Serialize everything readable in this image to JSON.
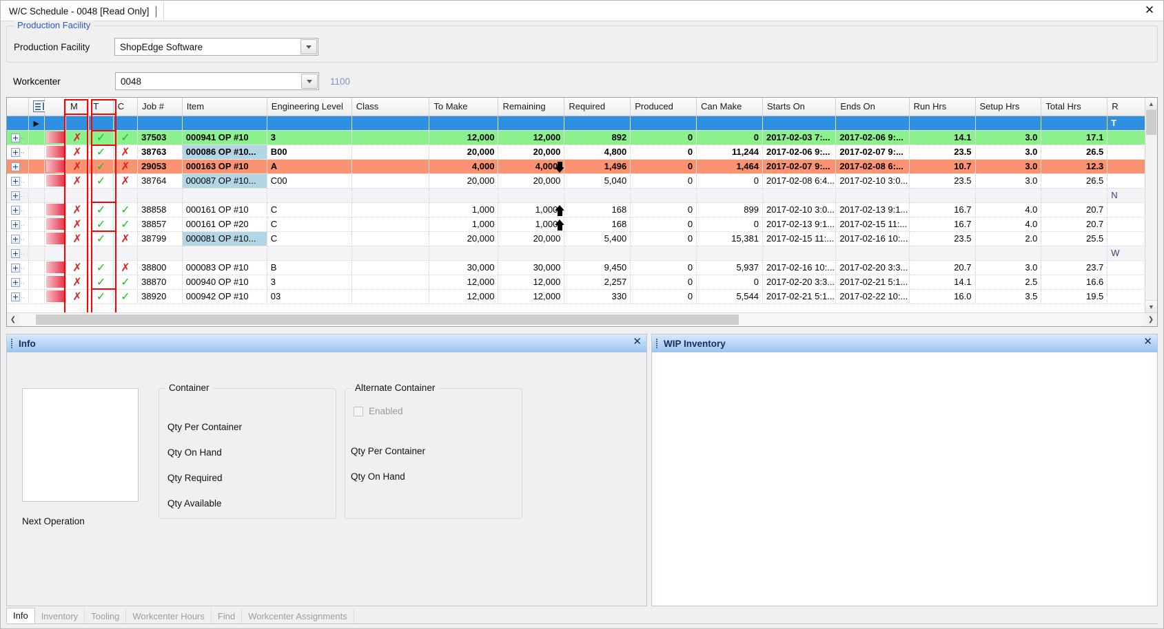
{
  "window": {
    "doc_tab_title": "W/C Schedule - 0048 [Read Only]",
    "close_label": "✕"
  },
  "form": {
    "group_title": "Production Facility",
    "facility_label": "Production Facility",
    "facility_value": "ShopEdge Software",
    "workcenter_label": "Workcenter",
    "workcenter_value": "0048",
    "workcenter_extra": "1100"
  },
  "grid": {
    "columns": [
      {
        "key": "exp",
        "label": ""
      },
      {
        "key": "ind",
        "label": ""
      },
      {
        "key": "mark",
        "label": ""
      },
      {
        "key": "m",
        "label": "M"
      },
      {
        "key": "t",
        "label": "T"
      },
      {
        "key": "c",
        "label": "C"
      },
      {
        "key": "job",
        "label": "Job #"
      },
      {
        "key": "item",
        "label": "Item"
      },
      {
        "key": "eng",
        "label": "Engineering Level"
      },
      {
        "key": "class",
        "label": "Class"
      },
      {
        "key": "tomake",
        "label": "To Make"
      },
      {
        "key": "rem",
        "label": "Remaining"
      },
      {
        "key": "req",
        "label": "Required"
      },
      {
        "key": "prod",
        "label": "Produced"
      },
      {
        "key": "canm",
        "label": "Can Make"
      },
      {
        "key": "start",
        "label": "Starts On"
      },
      {
        "key": "end",
        "label": "Ends On"
      },
      {
        "key": "run",
        "label": "Run Hrs"
      },
      {
        "key": "setup",
        "label": "Setup Hrs"
      },
      {
        "key": "total",
        "label": "Total Hrs"
      },
      {
        "key": "r",
        "label": "R"
      }
    ],
    "rows": [
      {
        "state": "selected",
        "m": "",
        "t": "",
        "c": "",
        "job": "",
        "item": "",
        "eng": "",
        "class": "",
        "tomake": "",
        "rem": "",
        "req": "",
        "prod": "",
        "canm": "",
        "start": "",
        "end": "",
        "run": "",
        "setup": "",
        "total": "",
        "r": "T"
      },
      {
        "state": "green",
        "m": "x",
        "t": "check",
        "c": "check",
        "job": "37503",
        "item": "000941 OP #10",
        "eng": "3",
        "class": "",
        "tomake": "12,000",
        "rem": "12,000",
        "req": "892",
        "prod": "0",
        "canm": "0",
        "start": "2017-02-03 7:...",
        "end": "2017-02-06 9:...",
        "run": "14.1",
        "setup": "3.0",
        "total": "17.1",
        "r": ""
      },
      {
        "state": "white",
        "m": "x",
        "t": "check",
        "c": "x",
        "job": "38763",
        "item": "000086 OP #10...",
        "item_highlight": true,
        "eng": "B00",
        "class": "",
        "tomake": "20,000",
        "rem": "20,000",
        "req": "4,800",
        "prod": "0",
        "canm": "11,244",
        "start": "2017-02-06 9:...",
        "end": "2017-02-07 9:...",
        "run": "23.5",
        "setup": "3.0",
        "total": "26.5",
        "r": "",
        "bold": true
      },
      {
        "state": "orange",
        "m": "x",
        "t": "check",
        "c": "x",
        "job": "29053",
        "item": "000163 OP #10",
        "eng": "A",
        "class": "",
        "tomake": "4,000",
        "rem": "4,000",
        "rem_arrow": "down",
        "req": "1,496",
        "prod": "0",
        "canm": "1,464",
        "start": "2017-02-07 9:...",
        "end": "2017-02-08 6:...",
        "run": "10.7",
        "setup": "3.0",
        "total": "12.3",
        "r": ""
      },
      {
        "state": "white",
        "m": "x",
        "t": "check",
        "c": "x",
        "job": "38764",
        "item": "000087 OP #10...",
        "item_highlight": true,
        "eng": "C00",
        "class": "",
        "tomake": "20,000",
        "rem": "20,000",
        "req": "5,040",
        "prod": "0",
        "canm": "0",
        "start": "2017-02-08 6:4...",
        "end": "2017-02-10 3:0...",
        "run": "23.5",
        "setup": "3.0",
        "total": "26.5",
        "r": ""
      },
      {
        "state": "separator",
        "m": "",
        "t": "",
        "c": "",
        "job": "",
        "item": "",
        "eng": "",
        "class": "",
        "tomake": "",
        "rem": "",
        "req": "",
        "prod": "",
        "canm": "",
        "start": "",
        "end": "",
        "run": "",
        "setup": "",
        "total": "",
        "r": "N"
      },
      {
        "state": "white",
        "m": "x",
        "t": "check",
        "c": "check",
        "job": "38858",
        "item": "000161 OP #10",
        "eng": "C",
        "class": "",
        "tomake": "1,000",
        "rem": "1,000",
        "rem_arrow": "up",
        "req": "168",
        "prod": "0",
        "canm": "899",
        "start": "2017-02-10 3:0...",
        "end": "2017-02-13 9:1...",
        "run": "16.7",
        "setup": "4.0",
        "total": "20.7",
        "r": ""
      },
      {
        "state": "white",
        "m": "x",
        "t": "check",
        "c": "check",
        "job": "38857",
        "item": "000161 OP #20",
        "eng": "C",
        "class": "",
        "tomake": "1,000",
        "rem": "1,000",
        "rem_arrow": "up",
        "req": "168",
        "prod": "0",
        "canm": "0",
        "start": "2017-02-13 9:1...",
        "end": "2017-02-15 11:...",
        "run": "16.7",
        "setup": "4.0",
        "total": "20.7",
        "r": ""
      },
      {
        "state": "white",
        "m": "x",
        "t": "check",
        "c": "x",
        "job": "38799",
        "item": "000081 OP #10...",
        "item_highlight": true,
        "eng": "C",
        "class": "",
        "tomake": "20,000",
        "rem": "20,000",
        "req": "5,400",
        "prod": "0",
        "canm": "15,381",
        "start": "2017-02-15 11:...",
        "end": "2017-02-16 10:...",
        "run": "23.5",
        "setup": "2.0",
        "total": "25.5",
        "r": ""
      },
      {
        "state": "separator",
        "m": "",
        "t": "",
        "c": "",
        "job": "",
        "item": "",
        "eng": "",
        "class": "",
        "tomake": "",
        "rem": "",
        "req": "",
        "prod": "",
        "canm": "",
        "start": "",
        "end": "",
        "run": "",
        "setup": "",
        "total": "",
        "r": "W"
      },
      {
        "state": "white",
        "m": "x",
        "t": "check",
        "c": "x",
        "job": "38800",
        "item": "000083 OP #10",
        "eng": "B",
        "class": "",
        "tomake": "30,000",
        "rem": "30,000",
        "req": "9,450",
        "prod": "0",
        "canm": "5,937",
        "start": "2017-02-16 10:...",
        "end": "2017-02-20 3:3...",
        "run": "20.7",
        "setup": "3.0",
        "total": "23.7",
        "r": ""
      },
      {
        "state": "white",
        "m": "x",
        "t": "check",
        "c": "check",
        "job": "38870",
        "item": "000940 OP #10",
        "eng": "3",
        "class": "",
        "tomake": "12,000",
        "rem": "12,000",
        "req": "2,257",
        "prod": "0",
        "canm": "0",
        "start": "2017-02-20 3:3...",
        "end": "2017-02-21 5:1...",
        "run": "14.1",
        "setup": "2.5",
        "total": "16.6",
        "r": ""
      },
      {
        "state": "white",
        "m": "x",
        "t": "check",
        "c": "check",
        "job": "38920",
        "item": "000942 OP #10",
        "eng": "03",
        "class": "",
        "tomake": "12,000",
        "rem": "12,000",
        "req": "330",
        "prod": "0",
        "canm": "5,544",
        "start": "2017-02-21 5:1...",
        "end": "2017-02-22 10:...",
        "run": "16.0",
        "setup": "3.5",
        "total": "19.5",
        "r": ""
      }
    ]
  },
  "info_pane": {
    "title": "Info",
    "close_label": "✕",
    "next_operation_label": "Next Operation",
    "container": {
      "caption": "Container",
      "qty_per_container": "Qty Per Container",
      "qty_on_hand": "Qty On Hand",
      "qty_required": "Qty Required",
      "qty_available": "Qty Available"
    },
    "alternate_container": {
      "caption": "Alternate Container",
      "enabled_label": "Enabled",
      "qty_per_container": "Qty Per Container",
      "qty_on_hand": "Qty On Hand"
    }
  },
  "wip_pane": {
    "title": "WIP Inventory",
    "close_label": "✕"
  },
  "tabs": [
    {
      "label": "Info",
      "active": true
    },
    {
      "label": "Inventory",
      "active": false
    },
    {
      "label": "Tooling",
      "active": false
    },
    {
      "label": "Workcenter Hours",
      "active": false
    },
    {
      "label": "Find",
      "active": false
    },
    {
      "label": "Workcenter Assignments",
      "active": false
    }
  ],
  "colors": {
    "selected_row": "#2f8fe0",
    "green_row": "#8cf08c",
    "orange_row": "#fb9272",
    "separator_row": "#f3f3f8",
    "item_highlight": "#b3d6e6",
    "mark_bar": "#e8384f",
    "check": "#17c217",
    "x_mark": "#e02020",
    "annotation_box": "#ff0000",
    "link_text": "#2a57c4",
    "pane_header": "#9dc4ef"
  }
}
